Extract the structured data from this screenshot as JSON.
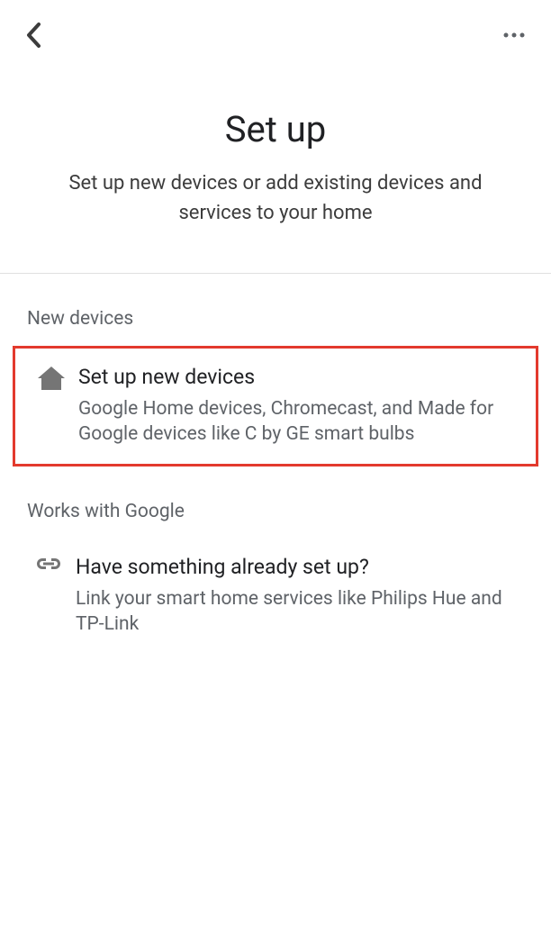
{
  "hero": {
    "title": "Set up",
    "subtitle": "Set up new devices or add existing devices and services to your home"
  },
  "sections": {
    "new_devices": {
      "label": "New devices",
      "item": {
        "title": "Set up new devices",
        "desc": "Google Home devices, Chromecast, and Made for Google devices like C by GE smart bulbs"
      }
    },
    "works_with": {
      "label": "Works with Google",
      "item": {
        "title": "Have something already set up?",
        "desc": "Link your smart home services like Philips Hue and TP-Link"
      }
    }
  }
}
